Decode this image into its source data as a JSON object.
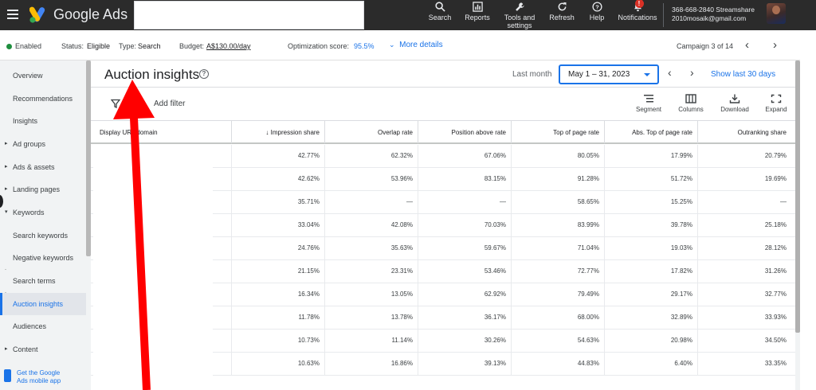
{
  "topbar": {
    "brand": "Google Ads",
    "tools": [
      {
        "label": "Search",
        "icon": "search-icon"
      },
      {
        "label": "Reports",
        "icon": "reports-icon"
      },
      {
        "label": "Tools and settings",
        "icon": "wrench-icon"
      },
      {
        "label": "Refresh",
        "icon": "refresh-icon"
      },
      {
        "label": "Help",
        "icon": "help-icon"
      },
      {
        "label": "Notifications",
        "icon": "bell-icon",
        "badge": "!"
      }
    ],
    "account_id": "368-668-2840 Streamshare",
    "account_email": "2010mosaik@gmail.com"
  },
  "status": {
    "state": "Enabled",
    "status_label": "Status:",
    "status_value": "Eligible",
    "type_label": "Type:",
    "type_value": "Search",
    "budget_label": "Budget:",
    "budget_value": "A$130.00/day",
    "opt_label": "Optimization score:",
    "opt_value": "95.5%",
    "more_details": "More details",
    "campaign_counter": "Campaign 3 of 14"
  },
  "sidebar": {
    "items": [
      {
        "label": "Overview"
      },
      {
        "label": "Recommendations"
      },
      {
        "label": "Insights"
      },
      {
        "label": "Ad groups"
      },
      {
        "label": "Ads & assets"
      },
      {
        "label": "Landing pages"
      },
      {
        "label": "Keywords"
      },
      {
        "label": "Search keywords"
      },
      {
        "label": "Negative keywords"
      },
      {
        "label": "Search terms"
      },
      {
        "label": "Auction insights"
      },
      {
        "label": "Audiences"
      },
      {
        "label": "Content"
      }
    ],
    "mobile_line1": "Get the Google",
    "mobile_line2": "Ads mobile app"
  },
  "main": {
    "title": "Auction insights",
    "date_label": "Last month",
    "date_range": "May 1 – 31, 2023",
    "show_last": "Show last 30 days",
    "add_filter": "Add filter",
    "controls": [
      "Segment",
      "Columns",
      "Download",
      "Expand"
    ]
  },
  "table": {
    "columns": [
      "Display URL domain",
      "Impression share",
      "Overlap rate",
      "Position above rate",
      "Top of page rate",
      "Abs. Top of page rate",
      "Outranking share"
    ],
    "rows": [
      [
        "",
        "42.77%",
        "62.32%",
        "67.06%",
        "80.05%",
        "17.99%",
        "20.79%"
      ],
      [
        "",
        "42.62%",
        "53.96%",
        "83.15%",
        "91.28%",
        "51.72%",
        "19.69%"
      ],
      [
        "",
        "35.71%",
        "—",
        "—",
        "58.65%",
        "15.25%",
        "—"
      ],
      [
        "",
        "33.04%",
        "42.08%",
        "70.03%",
        "83.99%",
        "39.78%",
        "25.18%"
      ],
      [
        "",
        "24.76%",
        "35.63%",
        "59.67%",
        "71.04%",
        "19.03%",
        "28.12%"
      ],
      [
        "",
        "21.15%",
        "23.31%",
        "53.46%",
        "72.77%",
        "17.82%",
        "31.26%"
      ],
      [
        "",
        "16.34%",
        "13.05%",
        "62.92%",
        "79.49%",
        "29.17%",
        "32.77%"
      ],
      [
        "",
        "11.78%",
        "13.78%",
        "36.17%",
        "68.00%",
        "32.89%",
        "33.93%"
      ],
      [
        "",
        "10.73%",
        "11.14%",
        "30.26%",
        "54.63%",
        "20.98%",
        "34.50%"
      ],
      [
        "",
        "10.63%",
        "16.86%",
        "39.13%",
        "44.83%",
        "6.40%",
        "33.35%"
      ]
    ]
  },
  "colors": {
    "accent": "#1a73e8",
    "topbar": "#2b2b2b",
    "annotation_arrow": "#ff0000",
    "enabled": "#1e8e3e"
  }
}
